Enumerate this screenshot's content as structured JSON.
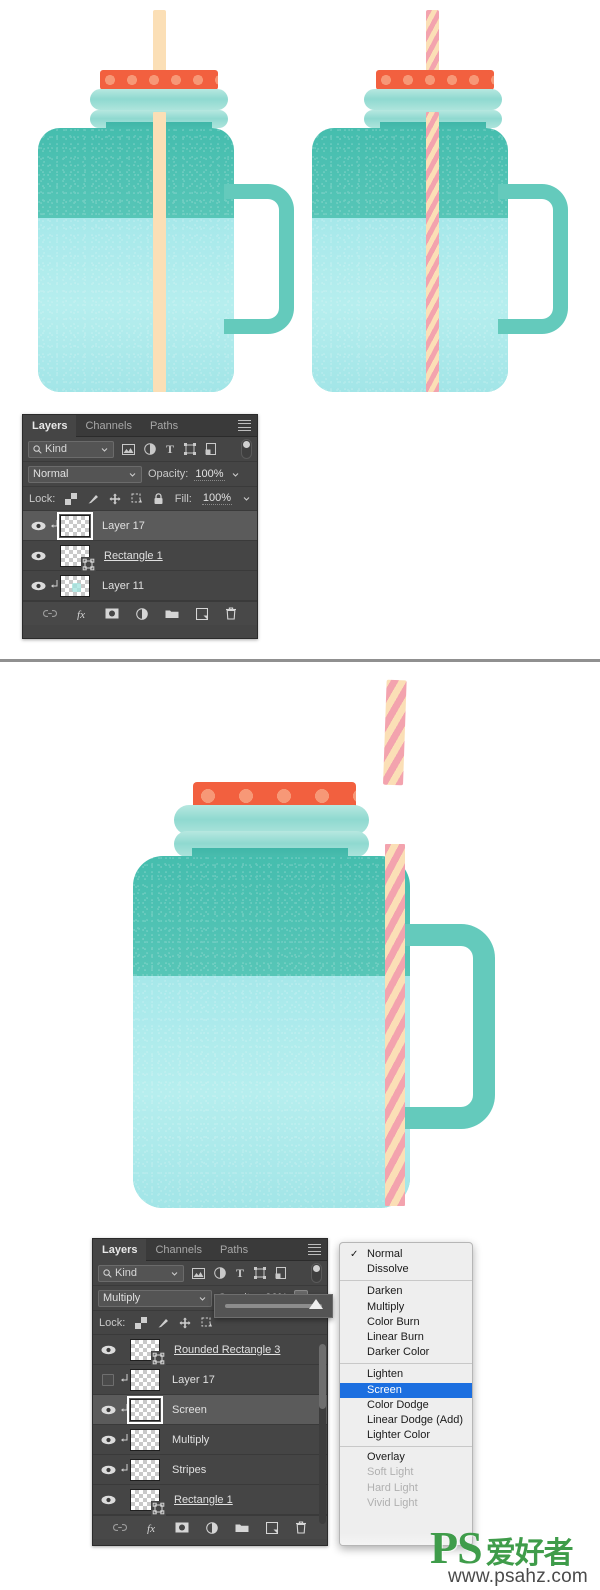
{
  "illustration": {
    "jars": [
      {
        "name": "jar-left-top",
        "straw_style": "plain",
        "straw_color": "#fbdfb6",
        "cap_color": "#f2603f",
        "ring_color": "#9ddcd3",
        "body_color": "#5dc9b8",
        "liquid_color": "#a8eaea"
      },
      {
        "name": "jar-right-top",
        "straw_style": "striped",
        "straw_colors": "#f3a3ae / #fbdfb6",
        "cap_color": "#f2603f",
        "ring_color": "#9ddcd3",
        "body_color": "#5dc9b8",
        "liquid_color": "#a8eaea"
      },
      {
        "name": "jar-large-bottom",
        "straw_style": "striped",
        "straw_colors": "#f3a3ae / #fbdfb6",
        "cap_color": "#f2603f",
        "ring_color": "#9ddcd3",
        "body_color": "#5dc9b8",
        "liquid_color": "#a8eaea"
      }
    ]
  },
  "panel_top": {
    "tabs": [
      {
        "label": "Layers",
        "active": true
      },
      {
        "label": "Channels",
        "active": false
      },
      {
        "label": "Paths",
        "active": false
      }
    ],
    "filter": {
      "kind_label": "Kind"
    },
    "blend_mode": "Normal",
    "opacity_label": "Opacity:",
    "opacity_value": "100%",
    "lock_label": "Lock:",
    "fill_label": "Fill:",
    "fill_value": "100%",
    "layers": [
      {
        "name": "Layer 17",
        "visible": true,
        "clipped": true,
        "selected": true,
        "vector": false,
        "thumb_focus": true
      },
      {
        "name": "Rectangle 1",
        "visible": true,
        "clipped": false,
        "selected": false,
        "vector": true,
        "thumb_focus": false
      },
      {
        "name": "Layer 11",
        "visible": true,
        "clipped": true,
        "selected": false,
        "vector": false,
        "thumb_focus": false
      }
    ]
  },
  "panel_bottom": {
    "tabs": [
      {
        "label": "Layers",
        "active": true
      },
      {
        "label": "Channels",
        "active": false
      },
      {
        "label": "Paths",
        "active": false
      }
    ],
    "filter": {
      "kind_label": "Kind"
    },
    "blend_mode": "Multiply",
    "opacity_label": "Opacity:",
    "opacity_value": "90%",
    "lock_label": "Lock:",
    "layers": [
      {
        "name": "Rounded Rectangle 3",
        "visible": true,
        "clipped": false,
        "selected": false,
        "vector": true,
        "thumb_focus": false
      },
      {
        "name": "Layer 17",
        "visible": false,
        "clipped": true,
        "selected": false,
        "vector": false,
        "thumb_focus": false
      },
      {
        "name": "Screen",
        "visible": true,
        "clipped": true,
        "selected": true,
        "vector": false,
        "thumb_focus": true
      },
      {
        "name": "Multiply",
        "visible": true,
        "clipped": true,
        "selected": false,
        "vector": false,
        "thumb_focus": false
      },
      {
        "name": "Stripes",
        "visible": true,
        "clipped": true,
        "selected": false,
        "vector": false,
        "thumb_focus": false
      },
      {
        "name": "Rectangle 1",
        "visible": true,
        "clipped": false,
        "selected": false,
        "vector": true,
        "thumb_focus": false
      }
    ]
  },
  "blend_menu": {
    "groups": [
      [
        {
          "label": "Normal",
          "state": "checked"
        },
        {
          "label": "Dissolve",
          "state": "normal"
        }
      ],
      [
        {
          "label": "Darken",
          "state": "normal"
        },
        {
          "label": "Multiply",
          "state": "normal"
        },
        {
          "label": "Color Burn",
          "state": "normal"
        },
        {
          "label": "Linear Burn",
          "state": "normal"
        },
        {
          "label": "Darker Color",
          "state": "normal"
        }
      ],
      [
        {
          "label": "Lighten",
          "state": "normal"
        },
        {
          "label": "Screen",
          "state": "highlight"
        },
        {
          "label": "Color Dodge",
          "state": "normal"
        },
        {
          "label": "Linear Dodge (Add)",
          "state": "normal"
        },
        {
          "label": "Lighter Color",
          "state": "normal"
        }
      ],
      [
        {
          "label": "Overlay",
          "state": "normal"
        },
        {
          "label": "Soft Light",
          "state": "disabled"
        },
        {
          "label": "Hard Light",
          "state": "disabled"
        },
        {
          "label": "Vivid Light",
          "state": "disabled"
        }
      ]
    ],
    "highlight_color": "#1c6fe0"
  },
  "watermark": {
    "ps": "PS",
    "cn": "爱好者",
    "url": "www.psahz.com",
    "color": "#3f9c4a"
  }
}
